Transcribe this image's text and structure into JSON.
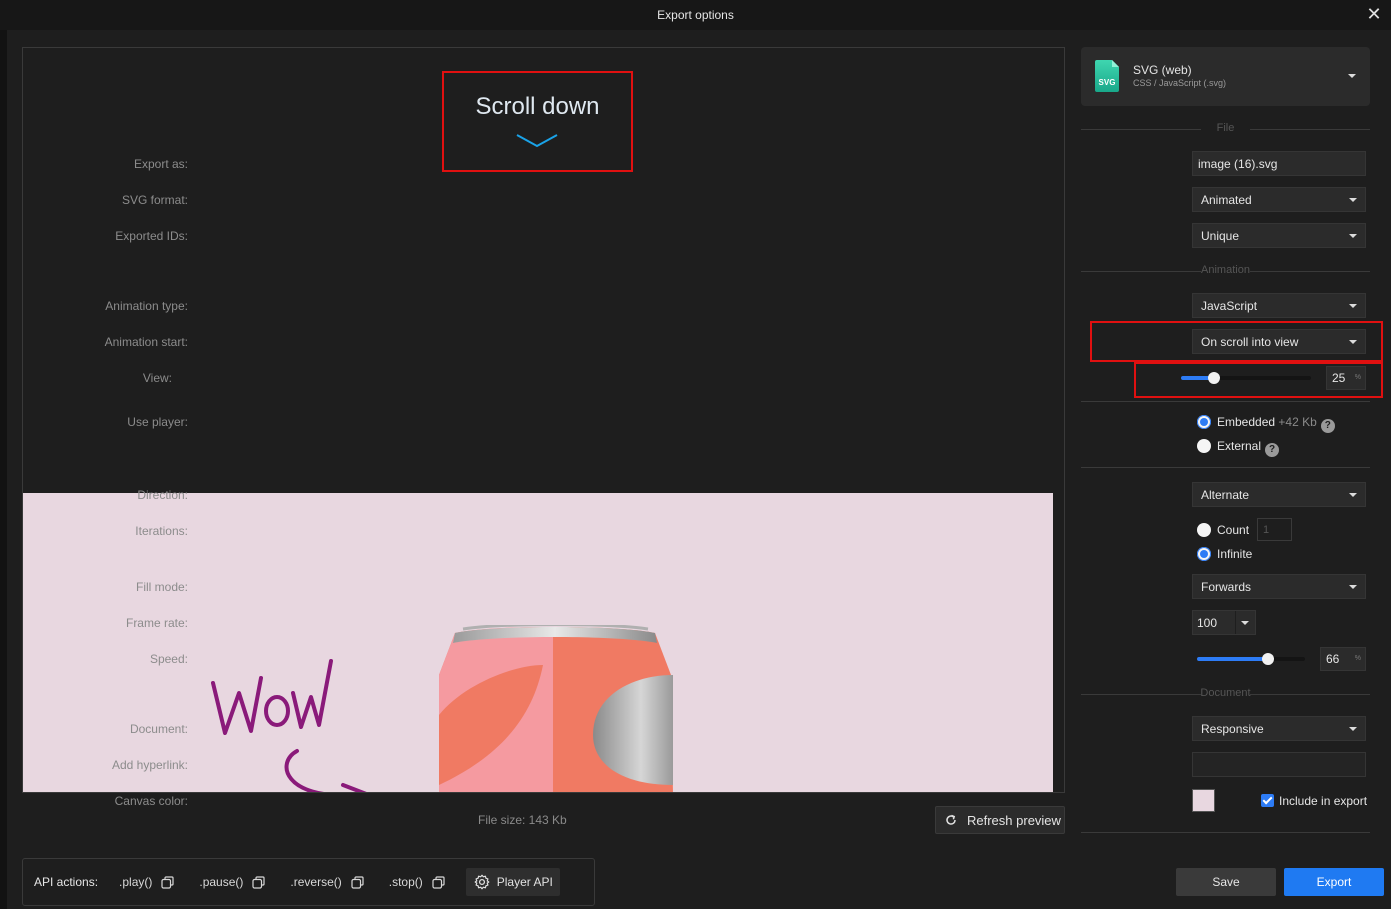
{
  "window": {
    "title": "Export options",
    "close_glyph": "✕"
  },
  "preview": {
    "scroll_hint": "Scroll down",
    "canvas_color": "#e8d7e0",
    "file_size": "File size: 143 Kb",
    "refresh_label": "Refresh preview"
  },
  "api": {
    "label": "API actions:",
    "actions": [
      ".play()",
      ".pause()",
      ".reverse()",
      ".stop()"
    ],
    "player_api_label": "Player API"
  },
  "format": {
    "icon_text": "SVG",
    "title": "SVG (web)",
    "subtitle": "CSS / JavaScript (.svg)"
  },
  "sections": {
    "file": "File",
    "animation": "Animation",
    "document": "Document"
  },
  "file": {
    "export_as_label": "Export as:",
    "export_as_value": "image (16).svg",
    "svg_format_label": "SVG format:",
    "svg_format_value": "Animated",
    "exported_ids_label": "Exported IDs:",
    "exported_ids_value": "Unique"
  },
  "animation": {
    "type_label": "Animation type:",
    "type_value": "JavaScript",
    "start_label": "Animation start:",
    "start_value": "On scroll into view",
    "view_label": "View:",
    "view_value": "25",
    "view_unit": "%",
    "view_fraction": 0.25,
    "use_player_label": "Use player:",
    "embedded_label": "Embedded",
    "embedded_size": "+42 Kb",
    "external_label": "External",
    "direction_label": "Direction:",
    "direction_value": "Alternate",
    "iterations_label": "Iterations:",
    "count_label": "Count",
    "count_value": "1",
    "infinite_label": "Infinite",
    "fill_mode_label": "Fill mode:",
    "fill_mode_value": "Forwards",
    "frame_rate_label": "Frame rate:",
    "frame_rate_value": "100",
    "speed_label": "Speed:",
    "speed_value": "66",
    "speed_unit": "%",
    "speed_fraction": 0.66
  },
  "document": {
    "document_label": "Document:",
    "document_value": "Responsive",
    "hyperlink_label": "Add hyperlink:",
    "hyperlink_value": "",
    "canvas_color_label": "Canvas color:",
    "include_label": "Include in export"
  },
  "footer": {
    "save_label": "Save",
    "export_label": "Export"
  },
  "colors": {
    "accent": "#2d7cf6",
    "highlight": "#e01010",
    "canvas": "#e8d7e0"
  }
}
